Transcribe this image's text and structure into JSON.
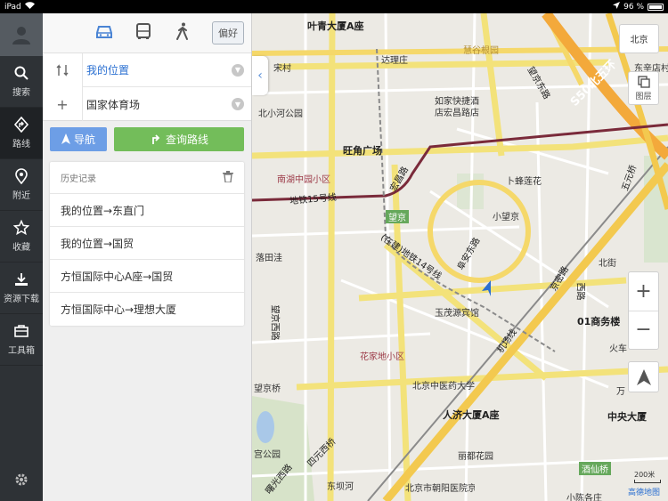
{
  "status": {
    "device": "iPad",
    "battery": "96 %"
  },
  "rail": {
    "items": [
      {
        "label": "搜索",
        "icon": "search-icon"
      },
      {
        "label": "路线",
        "icon": "route-icon"
      },
      {
        "label": "附近",
        "icon": "location-pin-icon"
      },
      {
        "label": "收藏",
        "icon": "star-icon"
      },
      {
        "label": "资源下载",
        "icon": "download-icon"
      },
      {
        "label": "工具箱",
        "icon": "toolbox-icon"
      }
    ]
  },
  "route": {
    "preference_label": "偏好",
    "from": "我的位置",
    "to": "国家体育场",
    "nav_label": "导航",
    "query_label": "查询路线"
  },
  "history": {
    "title": "历史记录",
    "items": [
      "我的位置→东直门",
      "我的位置→国贸",
      "方恒国际中心A座→国贸",
      "方恒国际中心→理想大厦"
    ]
  },
  "map": {
    "city_label": "北京",
    "layer_label": "图层",
    "scale_label": "200米",
    "brand_label": "高德地图",
    "labels": {
      "l1": "叶青大厦A座",
      "l2": "慧谷根园",
      "l3": "达理庄",
      "l4": "望京东路",
      "l5": "S50北五环",
      "l6": "东辛店村",
      "l7": "宋村",
      "l8": "北小河公园",
      "l9": "如家快捷酒店宏昌路店",
      "l10": "旺角广场",
      "l11": "南湖中园小区",
      "l12": "宏昌路",
      "l13": "卜蜂莲花",
      "l14": "地铁15号线",
      "l15": "望京",
      "l16": "小望京",
      "l17": "五元桥",
      "l18": "落田洼",
      "l19": "(在建)地铁14号线",
      "l20": "阜安东路",
      "l21": "北街",
      "l22": "京密路",
      "l23": "西路",
      "l24": "玉茂源宾馆",
      "l25": "01商务楼",
      "l26": "望京西路",
      "l27": "机场线",
      "l28": "花家地小区",
      "l29": "火车",
      "l30": "望京桥",
      "l31": "北京中医药大学",
      "l32": "万",
      "l33": "人济大厦A座",
      "l34": "中央大厦",
      "l35": "宫公园",
      "l36": "四元西桥",
      "l37": "丽都花园",
      "l38": "酒仙桥",
      "l39": "曙光西路",
      "l40": "东坝河",
      "l41": "北京市朝阳医院京西院区",
      "l42": "小陈各庄",
      "l43": "北京"
    }
  }
}
